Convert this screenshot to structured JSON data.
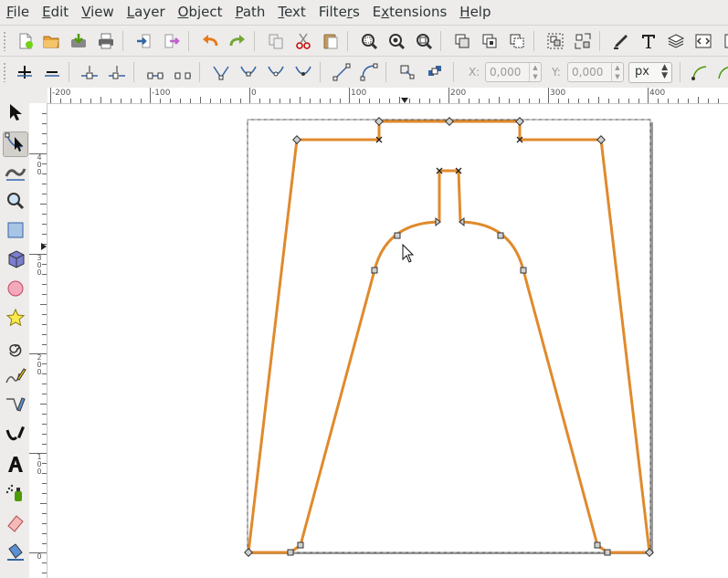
{
  "menu": [
    {
      "pre": "",
      "ul": "F",
      "post": "ile"
    },
    {
      "pre": "",
      "ul": "E",
      "post": "dit"
    },
    {
      "pre": "",
      "ul": "V",
      "post": "iew"
    },
    {
      "pre": "",
      "ul": "L",
      "post": "ayer"
    },
    {
      "pre": "",
      "ul": "O",
      "post": "bject"
    },
    {
      "pre": "",
      "ul": "P",
      "post": "ath"
    },
    {
      "pre": "",
      "ul": "T",
      "post": "ext"
    },
    {
      "pre": "Filte",
      "ul": "r",
      "post": "s"
    },
    {
      "pre": "E",
      "ul": "x",
      "post": "tensions"
    },
    {
      "pre": "",
      "ul": "H",
      "post": "elp"
    }
  ],
  "node_toolbar": {
    "x_label": "X:",
    "x_value": "0,000",
    "y_label": "Y:",
    "y_value": "0,000",
    "unit": "px"
  },
  "ruler": {
    "h_labels": [
      "-200",
      "-100",
      "0",
      "100",
      "200",
      "300",
      "400"
    ],
    "v_labels": [
      "400",
      "300",
      "200",
      "100",
      "0"
    ]
  },
  "colors": {
    "path_stroke": "#e08a2c",
    "node_fill": "#d0d0d0",
    "accent_blue": "#3465a4"
  },
  "active_tool": "node-tool"
}
